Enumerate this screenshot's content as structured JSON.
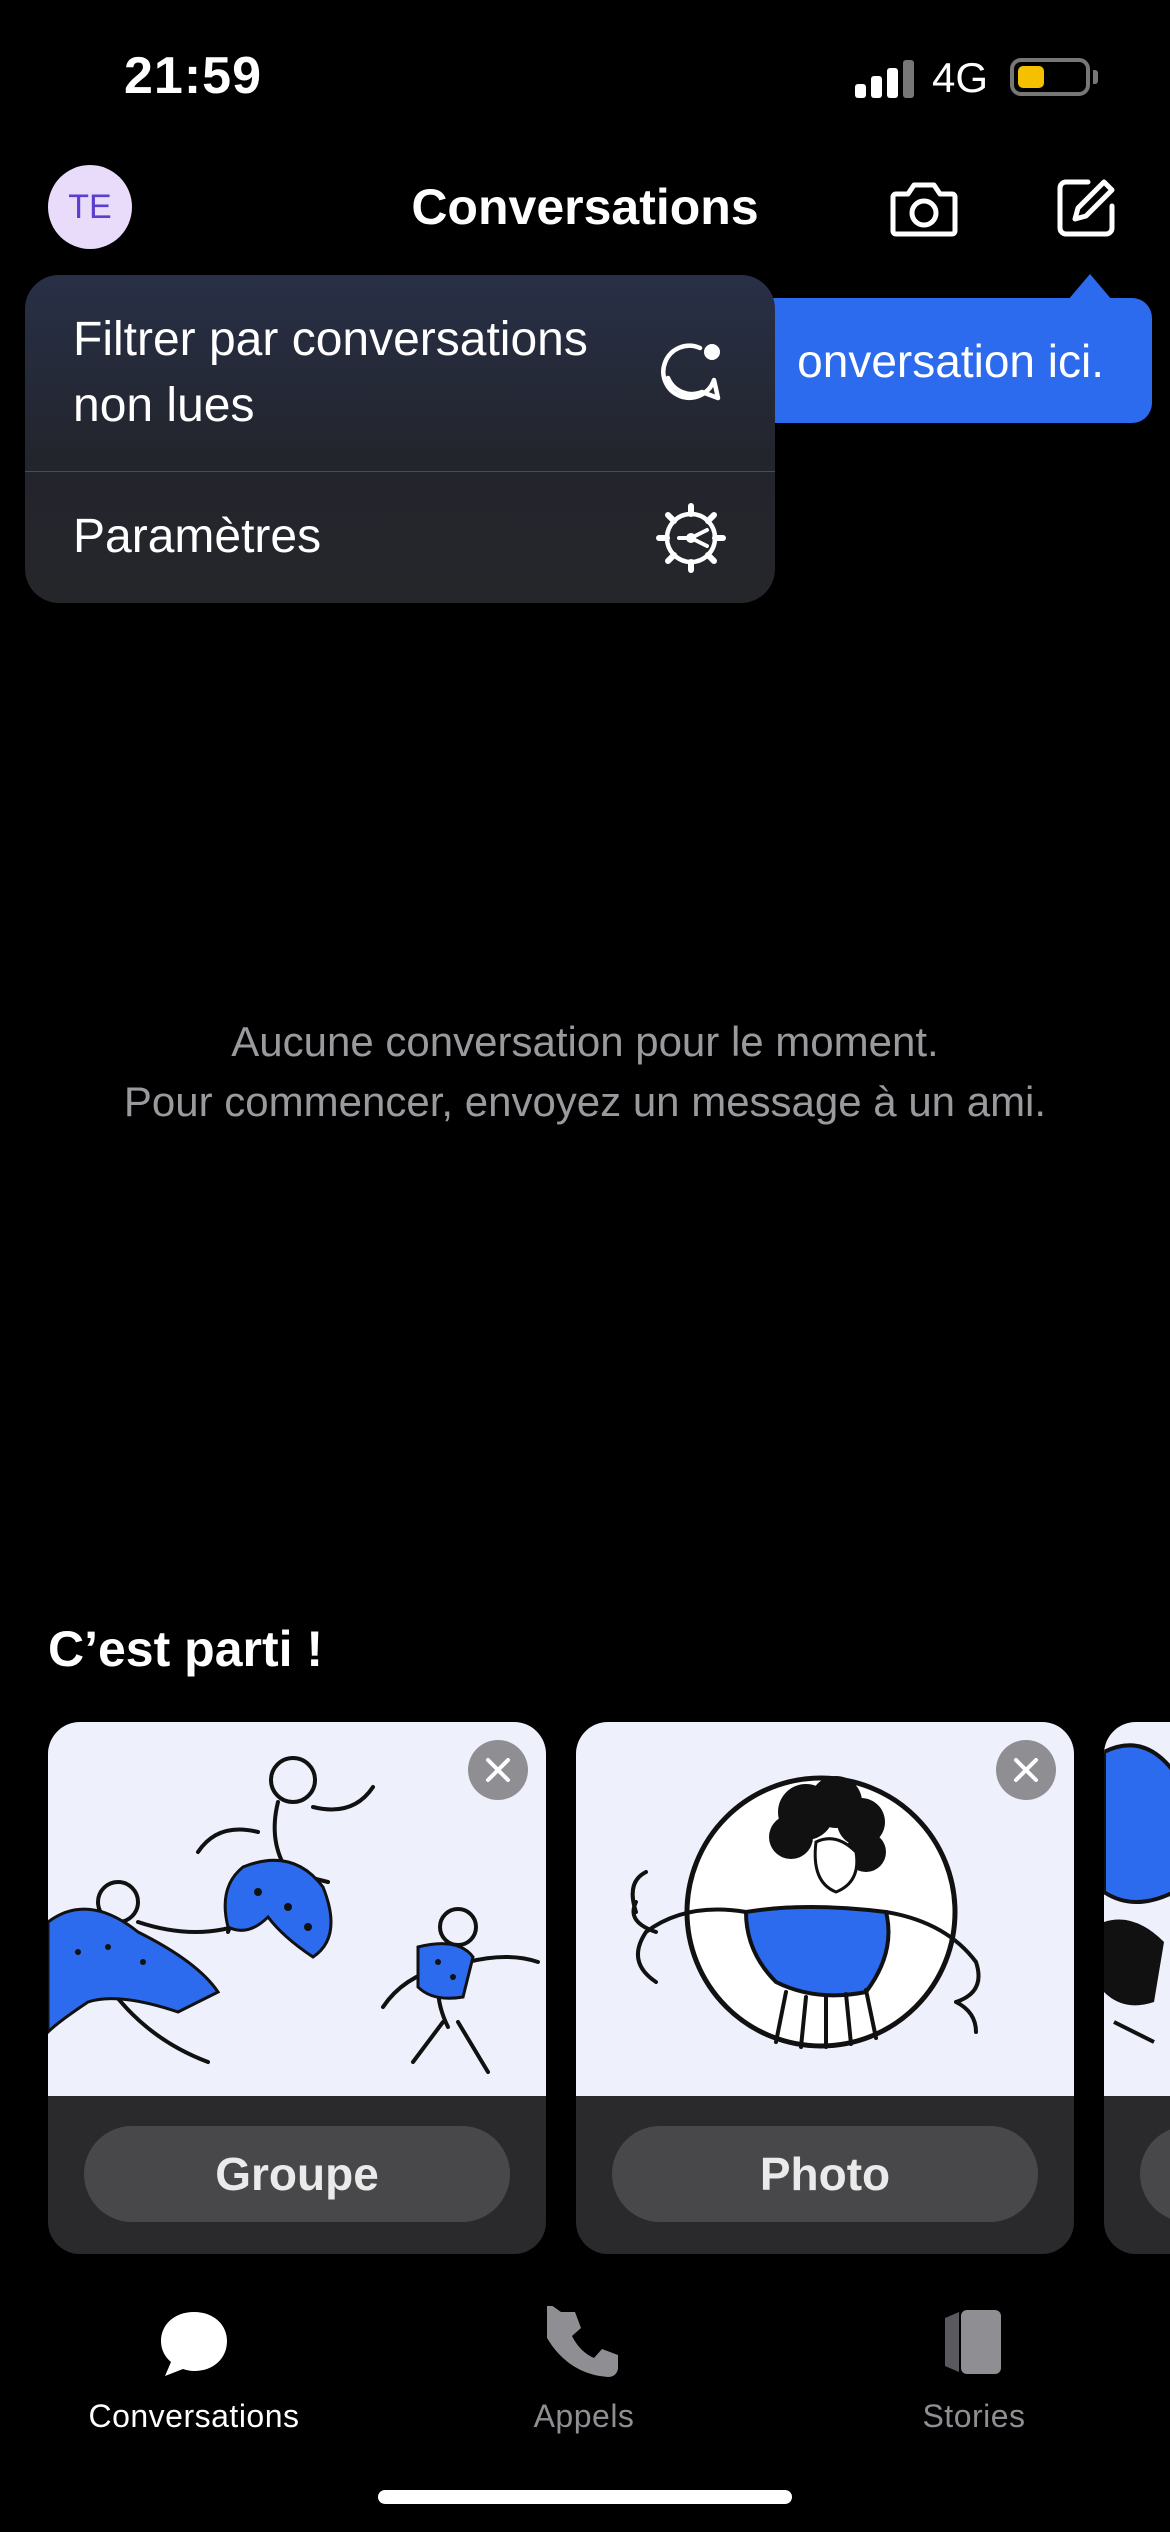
{
  "status_bar": {
    "time": "21:59",
    "network": "4G",
    "battery_level": 0.4
  },
  "header": {
    "avatar_initials": "TE",
    "title": "Conversations"
  },
  "tooltip": {
    "text": "onversation ici."
  },
  "menu": {
    "items": [
      {
        "label": "Filtrer par conversations non lues",
        "icon": "unread-chat-icon"
      },
      {
        "label": "Paramètres",
        "icon": "gear-icon"
      }
    ]
  },
  "empty_state": {
    "line1": "Aucune conversation pour le moment.",
    "line2": "Pour commencer, envoyez un message à un ami."
  },
  "onboarding": {
    "title": "C’est parti !",
    "cards": [
      {
        "label": "Groupe"
      },
      {
        "label": "Photo"
      }
    ]
  },
  "tab_bar": {
    "tabs": [
      {
        "label": "Conversations",
        "icon": "chat-bubble-icon",
        "active": true
      },
      {
        "label": "Appels",
        "icon": "phone-icon",
        "active": false
      },
      {
        "label": "Stories",
        "icon": "stories-icon",
        "active": false
      }
    ]
  },
  "colors": {
    "accent": "#2c6bed",
    "avatar_bg": "#e8dcfa",
    "avatar_text": "#5a3ecf",
    "battery": "#f5c000"
  }
}
